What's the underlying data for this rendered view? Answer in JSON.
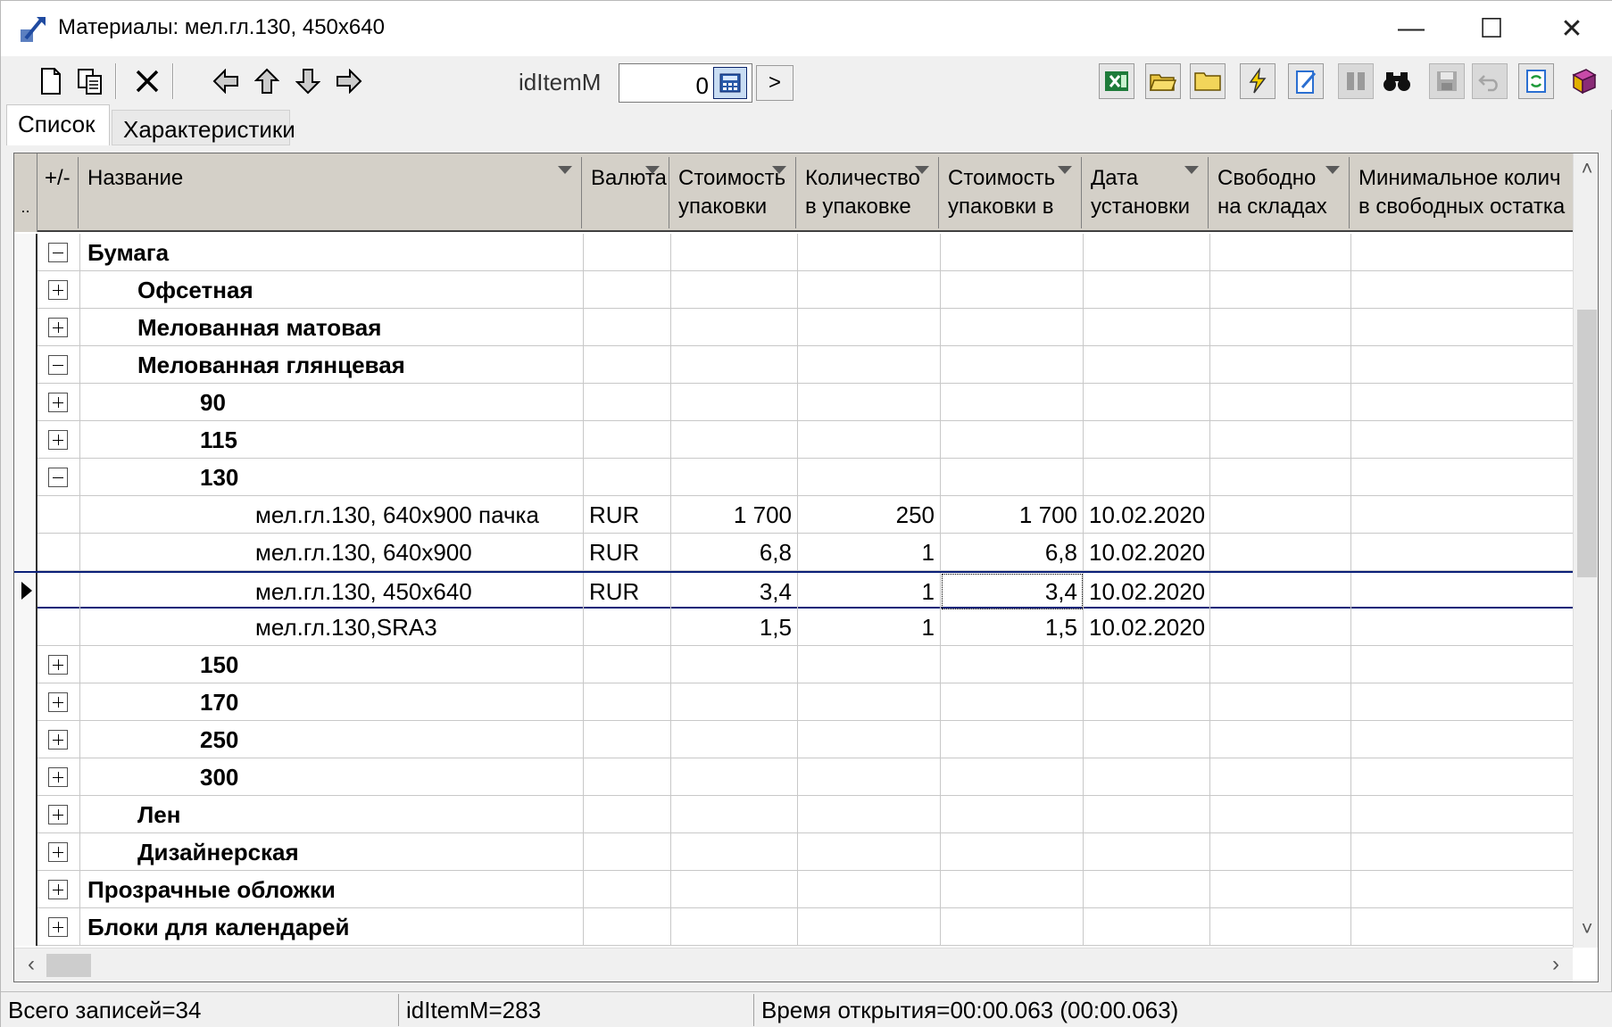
{
  "window": {
    "title": "Материалы: мел.гл.130, 450x640",
    "minimize": "—",
    "maximize": "☐",
    "close": "✕"
  },
  "toolbar": {
    "field_label": "idItemM",
    "field_value": "0",
    "go_label": ">"
  },
  "tabs": [
    {
      "label": "Список",
      "active": true
    },
    {
      "label": "Характеристики",
      "active": false
    }
  ],
  "grid": {
    "indicator_header": "..",
    "columns": [
      {
        "label": "+/-"
      },
      {
        "label": "Название"
      },
      {
        "label": "Валюта"
      },
      {
        "label": "Стоимость упаковки"
      },
      {
        "label": "Количество в упаковке"
      },
      {
        "label": "Стоимость упаковки в"
      },
      {
        "label": "Дата установки"
      },
      {
        "label": "Свободно на складах"
      },
      {
        "label": "Минимальное колич в свободных остатка"
      }
    ],
    "rows": [
      {
        "toggle": "minus",
        "name": "Бумага",
        "level": 0,
        "bold": true
      },
      {
        "toggle": "plus",
        "name": "Офсетная",
        "level": 1,
        "bold": true
      },
      {
        "toggle": "plus",
        "name": "Мелованная матовая",
        "level": 1,
        "bold": true
      },
      {
        "toggle": "minus",
        "name": "Мелованная глянцевая",
        "level": 1,
        "bold": true
      },
      {
        "toggle": "plus",
        "name": "90",
        "level": 2,
        "bold": true
      },
      {
        "toggle": "plus",
        "name": "115",
        "level": 2,
        "bold": true
      },
      {
        "toggle": "minus",
        "name": "130",
        "level": 2,
        "bold": true
      },
      {
        "toggle": "",
        "name": "мел.гл.130, 640x900 пачка",
        "level": 3,
        "bold": false,
        "currency": "RUR",
        "pack_cost": "1 700",
        "qty": "250",
        "pack_cost_in": "1 700",
        "date": "10.02.2020"
      },
      {
        "toggle": "",
        "name": "мел.гл.130, 640x900",
        "level": 3,
        "bold": false,
        "currency": "RUR",
        "pack_cost": "6,8",
        "qty": "1",
        "pack_cost_in": "6,8",
        "date": "10.02.2020"
      },
      {
        "toggle": "",
        "name": "мел.гл.130, 450x640",
        "level": 3,
        "bold": false,
        "currency": "RUR",
        "pack_cost": "3,4",
        "qty": "1",
        "pack_cost_in": "3,4",
        "date": "10.02.2020",
        "selected": true
      },
      {
        "toggle": "",
        "name": "мел.гл.130,SRA3",
        "level": 3,
        "bold": false,
        "currency": "",
        "pack_cost": "1,5",
        "qty": "1",
        "pack_cost_in": "1,5",
        "date": "10.02.2020"
      },
      {
        "toggle": "plus",
        "name": "150",
        "level": 2,
        "bold": true
      },
      {
        "toggle": "plus",
        "name": "170",
        "level": 2,
        "bold": true
      },
      {
        "toggle": "plus",
        "name": "250",
        "level": 2,
        "bold": true
      },
      {
        "toggle": "plus",
        "name": "300",
        "level": 2,
        "bold": true
      },
      {
        "toggle": "plus",
        "name": "Лен",
        "level": 1,
        "bold": true
      },
      {
        "toggle": "plus",
        "name": "Дизайнерская",
        "level": 1,
        "bold": true
      },
      {
        "toggle": "plus",
        "name": "Прозрачные обложки",
        "level": 0,
        "bold": true
      },
      {
        "toggle": "plus",
        "name": "Блоки для календарей",
        "level": 0,
        "bold": true
      }
    ]
  },
  "status": {
    "records": "Всего записей=34",
    "item": "idItemM=283",
    "time": "Время открытия=00:00.063 (00:00.063)"
  }
}
